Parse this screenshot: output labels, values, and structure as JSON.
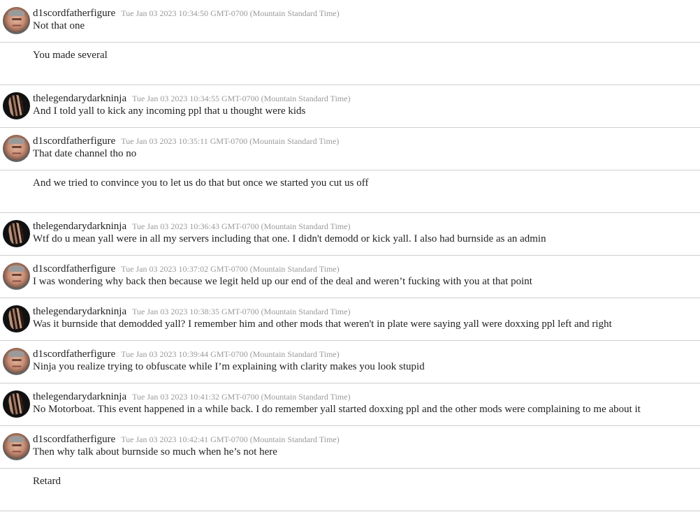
{
  "messages": [
    {
      "author": "d1scordfatherfigure",
      "avatar": "father-avatar",
      "timestamp": "Tue Jan 03 2023 10:34:50 GMT-0700 (Mountain Standard Time)",
      "text": "Not that one"
    },
    {
      "author": null,
      "timestamp": null,
      "text": "You made several"
    },
    {
      "author": "thelegendarydarkninja",
      "avatar": "ninja-avatar",
      "timestamp": "Tue Jan 03 2023 10:34:55 GMT-0700 (Mountain Standard Time)",
      "text": "And I told yall to kick any incoming ppl that u thought were kids"
    },
    {
      "author": "d1scordfatherfigure",
      "avatar": "father-avatar",
      "timestamp": "Tue Jan 03 2023 10:35:11 GMT-0700 (Mountain Standard Time)",
      "text": "That date channel tho no"
    },
    {
      "author": null,
      "timestamp": null,
      "text": "And we tried to convince you to let us do that but once we started you cut us off"
    },
    {
      "author": "thelegendarydarkninja",
      "avatar": "ninja-avatar",
      "timestamp": "Tue Jan 03 2023 10:36:43 GMT-0700 (Mountain Standard Time)",
      "text": "Wtf do u mean yall were in all my servers including that one. I didn't demodd or kick yall. I also had burnside as an admin"
    },
    {
      "author": "d1scordfatherfigure",
      "avatar": "father-avatar",
      "timestamp": "Tue Jan 03 2023 10:37:02 GMT-0700 (Mountain Standard Time)",
      "text": "I was wondering why back then because we legit held up our end of the deal and weren’t fucking with you at that point"
    },
    {
      "author": "thelegendarydarkninja",
      "avatar": "ninja-avatar",
      "timestamp": "Tue Jan 03 2023 10:38:35 GMT-0700 (Mountain Standard Time)",
      "text": "Was it burnside that demodded yall? I remember him and other mods that weren't in plate were saying yall were doxxing ppl left and right"
    },
    {
      "author": "d1scordfatherfigure",
      "avatar": "father-avatar",
      "timestamp": "Tue Jan 03 2023 10:39:44 GMT-0700 (Mountain Standard Time)",
      "text": "Ninja you realize trying to obfuscate while I’m explaining with clarity makes you look stupid"
    },
    {
      "author": "thelegendarydarkninja",
      "avatar": "ninja-avatar",
      "timestamp": "Tue Jan 03 2023 10:41:32 GMT-0700 (Mountain Standard Time)",
      "text": "No Motorboat. This event happened in a while back. I do remember yall started doxxing ppl and the other mods were complaining to me about it"
    },
    {
      "author": "d1scordfatherfigure",
      "avatar": "father-avatar",
      "timestamp": "Tue Jan 03 2023 10:42:41 GMT-0700 (Mountain Standard Time)",
      "text": "Then why talk about burnside so much when he’s not here"
    },
    {
      "author": null,
      "timestamp": null,
      "text": "Retard"
    }
  ]
}
